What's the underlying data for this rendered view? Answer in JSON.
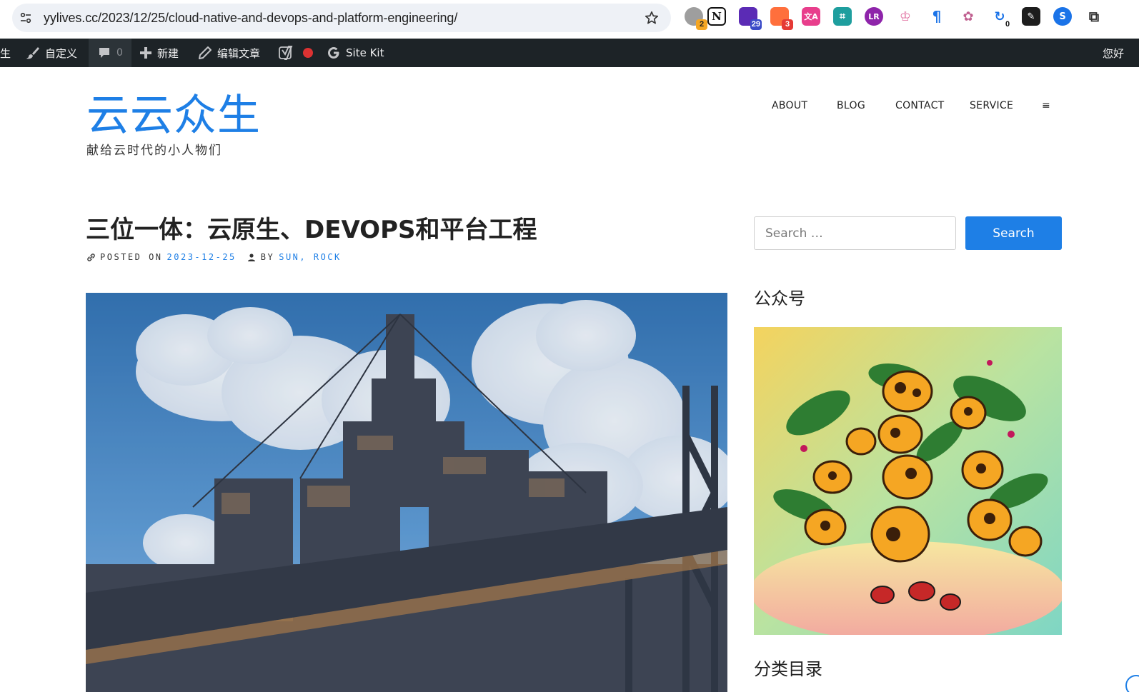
{
  "browser": {
    "url": "yylives.cc/2023/12/25/cloud-native-and-devops-and-platform-engineering/",
    "extensions": [
      {
        "icon": "gray-circle-extension-icon",
        "badge": "2",
        "badge_color": "#f5a623"
      },
      {
        "icon": "notion-extension-icon",
        "badge": "",
        "badge_color": ""
      },
      {
        "icon": "house-extension-icon",
        "badge": "29",
        "badge_color": "#3b4bc8"
      },
      {
        "icon": "chat-extension-icon",
        "badge": "3",
        "badge_color": "#e53935"
      },
      {
        "icon": "translate-extension-icon",
        "badge": "",
        "badge_color": ""
      },
      {
        "icon": "grid-extension-icon",
        "badge": "",
        "badge_color": ""
      },
      {
        "icon": "purple-extension-icon",
        "badge": "",
        "badge_color": ""
      },
      {
        "icon": "crown-extension-icon",
        "badge": "",
        "badge_color": ""
      },
      {
        "icon": "blue-pin-extension-icon",
        "badge": "",
        "badge_color": ""
      },
      {
        "icon": "openai-extension-icon",
        "badge": "",
        "badge_color": ""
      },
      {
        "icon": "refresh-extension-icon",
        "badge": "0",
        "badge_color": ""
      },
      {
        "icon": "black-square-extension-icon",
        "badge": "",
        "badge_color": ""
      },
      {
        "icon": "blue-circle-extension-icon",
        "badge": "",
        "badge_color": ""
      },
      {
        "icon": "puzzle-extension-icon",
        "badge": "",
        "badge_color": ""
      }
    ]
  },
  "admin_bar": {
    "site_fragment": "生",
    "customize": "自定义",
    "comments_count": "0",
    "new": "新建",
    "edit_post": "编辑文章",
    "site_kit": "Site Kit",
    "greeting": "您好"
  },
  "site": {
    "title": "云云众生",
    "tagline": "献给云时代的小人物们"
  },
  "nav": {
    "items": [
      "ABOUT",
      "BLOG",
      "CONTACT",
      "SERVICE"
    ],
    "menu_glyph": "≡"
  },
  "post": {
    "title": "三位一体：云原生、DEVOPS和平台工程",
    "posted_on_label": "POSTED ON",
    "date": "2023-12-25",
    "by_label": "BY",
    "author": "SUN, ROCK"
  },
  "sidebar": {
    "search_placeholder": "Search …",
    "search_button": "Search",
    "widget_wechat": "公众号",
    "widget_categories": "分类目录"
  },
  "colors": {
    "accent": "#1e7fe6",
    "admin_bar": "#1d2327"
  }
}
